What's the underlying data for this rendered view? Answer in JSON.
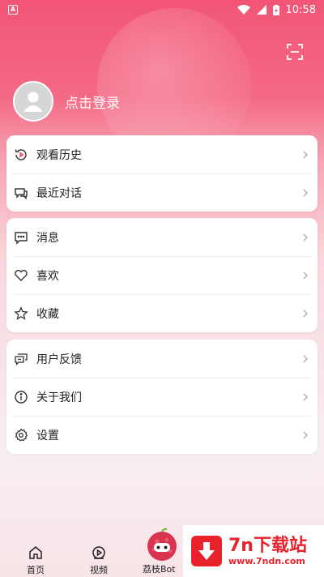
{
  "status_bar": {
    "app_badge": "A",
    "time": "10:58"
  },
  "profile": {
    "login_label": "点击登录"
  },
  "card1": {
    "items": [
      {
        "icon": "history-icon",
        "label": "观看历史"
      },
      {
        "icon": "chat-icon",
        "label": "最近对话"
      }
    ]
  },
  "card2": {
    "items": [
      {
        "icon": "message-icon",
        "label": "消息"
      },
      {
        "icon": "heart-icon",
        "label": "喜欢"
      },
      {
        "icon": "star-icon",
        "label": "收藏"
      }
    ]
  },
  "card3": {
    "items": [
      {
        "icon": "feedback-icon",
        "label": "用户反馈"
      },
      {
        "icon": "info-icon",
        "label": "关于我们"
      },
      {
        "icon": "gear-icon",
        "label": "设置"
      }
    ]
  },
  "nav": {
    "home": "首页",
    "video": "视频",
    "lizhi": "荔枝Bot"
  },
  "watermark": {
    "title": "7n下载站",
    "url": "www.7ndn.com"
  },
  "colors": {
    "accent": "#f25576",
    "watermark": "#e8222a"
  }
}
